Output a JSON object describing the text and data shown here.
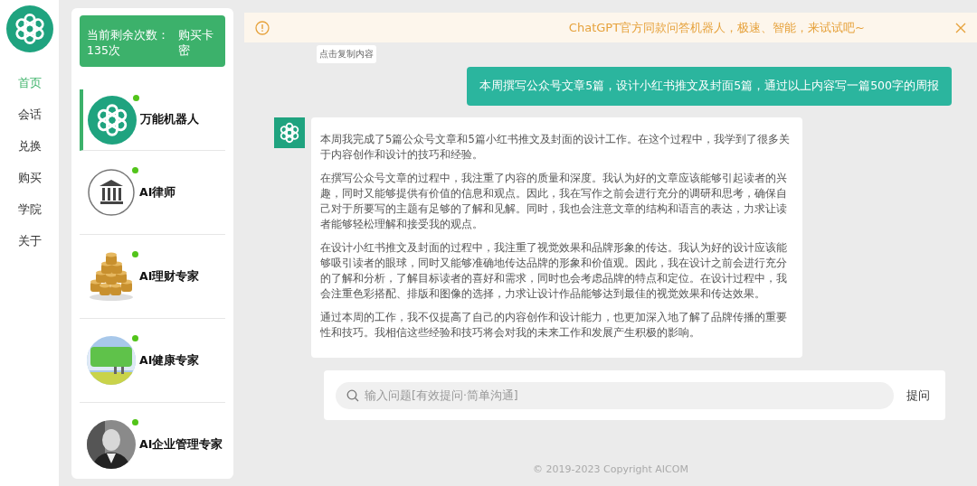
{
  "nav": {
    "items": [
      {
        "label": "首页",
        "selected": true
      },
      {
        "label": "会话",
        "selected": false
      },
      {
        "label": "兑换",
        "selected": false
      },
      {
        "label": "购买",
        "selected": false
      },
      {
        "label": "学院",
        "selected": false
      },
      {
        "label": "关于",
        "selected": false
      }
    ]
  },
  "quota": {
    "remaining": "当前剩余次数：135次",
    "buy": "购买卡密"
  },
  "bots": [
    {
      "name": "万能机器人",
      "kind": "logo",
      "online": true,
      "selected": true
    },
    {
      "name": "AI律师",
      "kind": "court",
      "online": true,
      "selected": false
    },
    {
      "name": "AI理财专家",
      "kind": "coins",
      "online": true,
      "selected": false
    },
    {
      "name": "AI健康专家",
      "kind": "meadow",
      "online": true,
      "selected": false
    },
    {
      "name": "AI企业管理专家",
      "kind": "portrait",
      "online": true,
      "selected": false
    }
  ],
  "banner": {
    "text": "ChatGPT官方同款问答机器人，极速、智能，来试试吧~"
  },
  "messages": [
    {
      "kind": "user",
      "copy_label": "点击复制内容",
      "text": "本周撰写公众号文章5篇，设计小红书推文及封面5篇，通过以上内容写一篇500字的周报"
    },
    {
      "kind": "assistant",
      "paragraphs": [
        "本周我完成了5篇公众号文章和5篇小红书推文及封面的设计工作。在这个过程中，我学到了很多关于内容创作和设计的技巧和经验。",
        "在撰写公众号文章的过程中，我注重了内容的质量和深度。我认为好的文章应该能够引起读者的兴趣，同时又能够提供有价值的信息和观点。因此，我在写作之前会进行充分的调研和思考，确保自己对于所要写的主题有足够的了解和见解。同时，我也会注意文章的结构和语言的表达，力求让读者能够轻松理解和接受我的观点。",
        "在设计小红书推文及封面的过程中，我注重了视觉效果和品牌形象的传达。我认为好的设计应该能够吸引读者的眼球，同时又能够准确地传达品牌的形象和价值观。因此，我在设计之前会进行充分的了解和分析，了解目标读者的喜好和需求，同时也会考虑品牌的特点和定位。在设计过程中，我会注重色彩搭配、排版和图像的选择，力求让设计作品能够达到最佳的视觉效果和传达效果。",
        "通过本周的工作，我不仅提高了自己的内容创作和设计能力，也更加深入地了解了品牌传播的重要性和技巧。我相信这些经验和技巧将会对我的未来工作和发展产生积极的影响。"
      ]
    }
  ],
  "input": {
    "placeholder": "输入问题[有效提问·简单沟通]",
    "submit": "提问"
  },
  "footer": "© 2019-2023 Copyright AICOM"
}
